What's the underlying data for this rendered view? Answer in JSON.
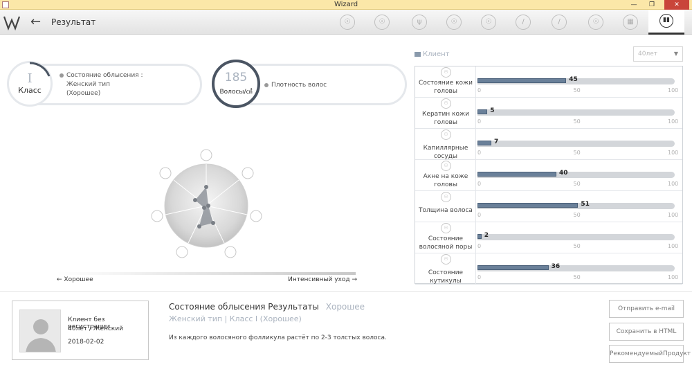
{
  "window": {
    "title": "Wizard",
    "minimize": "—",
    "restore": "❐",
    "close": "✕"
  },
  "toolbar": {
    "back_icon": "←",
    "page_title": "Результат",
    "logo": "W"
  },
  "class_card": {
    "value": "I",
    "label": "Класс",
    "desc_line1": "Состояние облысения  :",
    "desc_line2": "Женский тип",
    "desc_line3": "(Хорошее)"
  },
  "density_card": {
    "value": "185",
    "unit": "Волосы/㎠",
    "desc": "Плотность волос"
  },
  "radar": {
    "left_label": "← Хорошее",
    "right_label": "Интенсивный уход →"
  },
  "client_panel": {
    "label": "Клиент",
    "age_select": "40лет"
  },
  "axis_ticks": [
    "0",
    "50",
    "100"
  ],
  "chart_data": {
    "type": "bar",
    "categories": [
      "Состояние кожи головы",
      "Кератин кожи головы",
      "Капиллярные сосуды",
      "Акне на коже головы",
      "Толщина волоса",
      "Состояние волосяной поры",
      "Состояние кутикулы"
    ],
    "values": [
      45,
      5,
      7,
      40,
      51,
      2,
      36
    ],
    "ylim": [
      0,
      100
    ]
  },
  "client_card": {
    "name": "Клиент без регистрации",
    "info": "40лет / Женский",
    "date": "2018-02-02"
  },
  "result": {
    "title": "Состояние облысения Результаты",
    "status": "Хорошее",
    "subtitle": "Женский тип | Класс I (Хорошее)",
    "description": "Из каждого волосяного фолликула растёт по 2-3 толстых волоса."
  },
  "buttons": {
    "email": "Отправить e-mail",
    "html": "Сохранить в HTML",
    "product": "РекомендуемыйПродукт"
  }
}
